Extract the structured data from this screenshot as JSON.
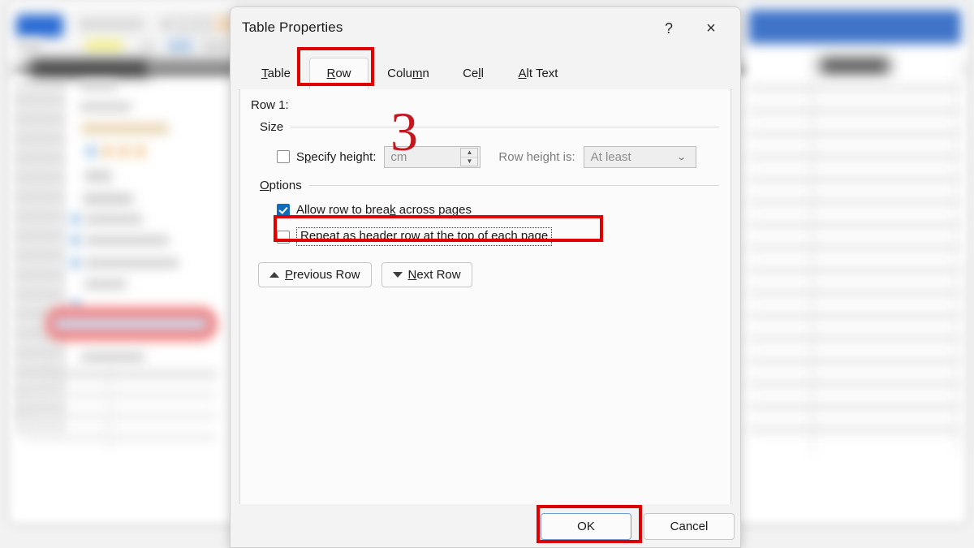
{
  "background": {
    "app": "word-document-blurred",
    "description": "blurred Microsoft Word document with ribbon, context menu and a table"
  },
  "dialog": {
    "title": "Table Properties",
    "help_label": "?",
    "close_label": "×",
    "tabs": [
      {
        "id": "table",
        "label": "Table",
        "acc": "T",
        "rest": "able",
        "active": false
      },
      {
        "id": "row",
        "label": "Row",
        "acc": "R",
        "rest": "ow",
        "active": true
      },
      {
        "id": "column",
        "label": "Column",
        "pre": "Colu",
        "acc": "m",
        "rest": "n",
        "active": false
      },
      {
        "id": "cell",
        "label": "Cell",
        "pre": "Ce",
        "acc": "l",
        "rest": "l",
        "active": false
      },
      {
        "id": "alt_text",
        "label": "Alt Text",
        "acc": "A",
        "rest": "lt Text",
        "active": false
      }
    ],
    "row_label": "Row 1:",
    "size": {
      "group_label": "Size",
      "specify_height": {
        "label_pre": "S",
        "label_acc": "p",
        "label_rest": "ecify height:",
        "full_label": "Specify height:",
        "checked": false
      },
      "height_value": "",
      "height_unit": "cm",
      "height_disabled": true,
      "spinner_up": "▲",
      "spinner_down": "▼",
      "row_height_is_label": "Row height is:",
      "row_height_is_value": "At least",
      "row_height_is_disabled": true,
      "dropdown_arrow": "⌄"
    },
    "options": {
      "group_label_acc": "O",
      "group_label_rest": "ptions",
      "group_label": "Options",
      "items": [
        {
          "id": "allow_break",
          "pre": "Allow row to brea",
          "acc": "k",
          "rest": " across pages",
          "full_label": "Allow row to break across pages",
          "checked": true,
          "focused": false
        },
        {
          "id": "repeat_header",
          "pre": "Repeat as ",
          "acc": "h",
          "rest": "eader row at the top of each page",
          "full_label": "Repeat as header row at the top of each page",
          "checked": false,
          "focused": true
        }
      ]
    },
    "navigation": [
      {
        "id": "previous_row",
        "icon": "triangle-up",
        "pre": "",
        "acc": "P",
        "rest": "revious Row",
        "full_label": "Previous Row"
      },
      {
        "id": "next_row",
        "icon": "triangle-down",
        "pre": "",
        "acc": "N",
        "rest": "ext Row",
        "full_label": "Next Row"
      }
    ],
    "footer": {
      "ok_label": "OK",
      "cancel_label": "Cancel",
      "default_button": "ok"
    }
  },
  "annotations": {
    "step_number": "3",
    "color": "#c4161c",
    "highlight_color": "#e00000",
    "boxes": [
      "row-tab",
      "repeat-header-row-checkbox",
      "ok-button"
    ]
  },
  "colors": {
    "accent_blue": "#0f6cbd",
    "annotation_red": "#e00000",
    "dialog_bg": "#f3f3f3",
    "panel_bg": "#fbfbfb",
    "disabled_text": "#8c8c8c"
  }
}
